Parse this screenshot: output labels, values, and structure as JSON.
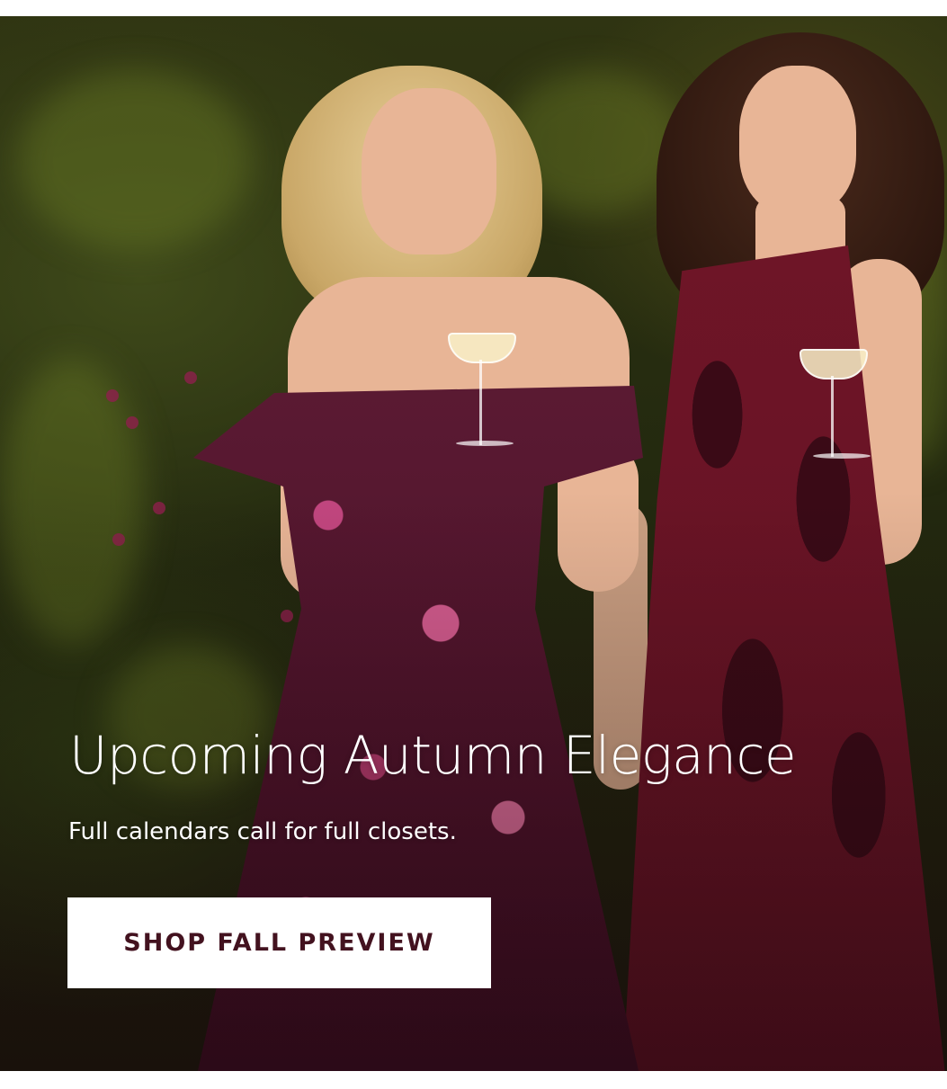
{
  "hero": {
    "headline": "Upcoming Autumn Elegance",
    "subheadline": "Full calendars call for full closets.",
    "cta_label": "SHOP FALL PREVIEW",
    "image_subject": "hero-photo-two-women-in-gowns"
  },
  "colors": {
    "cta_text": "#43121f",
    "cta_background": "#ffffff",
    "headline_text": "#ffffff",
    "dress_burgundy": "#6e1527",
    "floral_dress_base": "#4c1229"
  }
}
